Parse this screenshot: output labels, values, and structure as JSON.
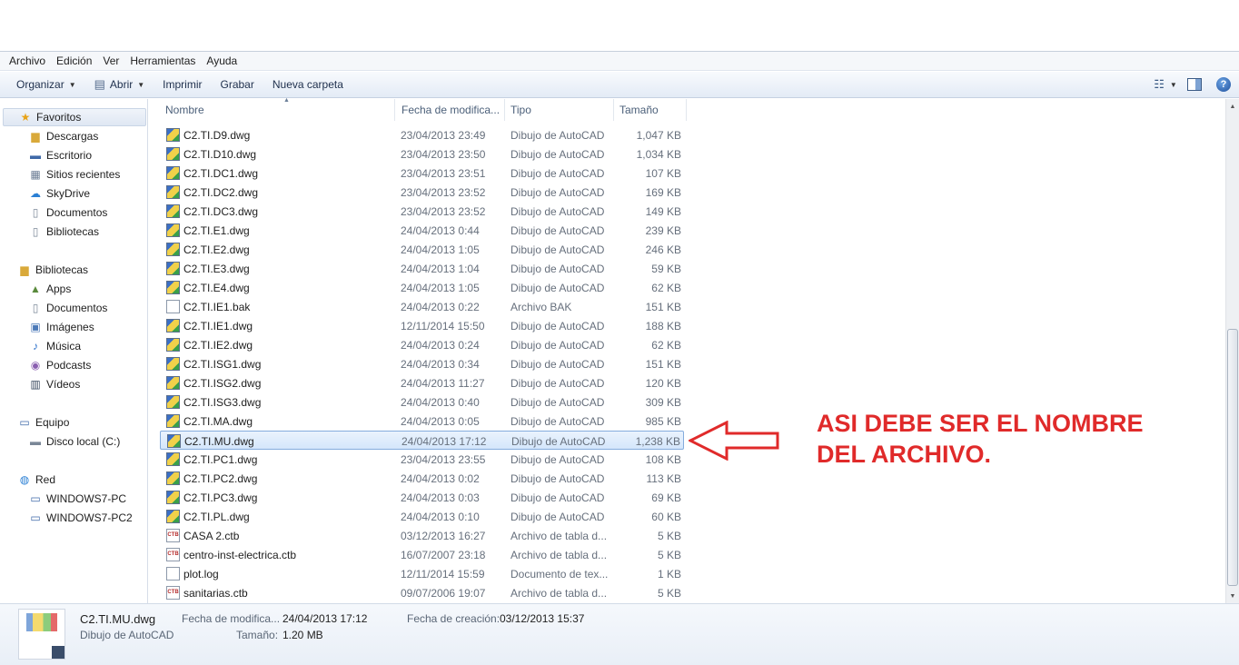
{
  "menu": [
    "Archivo",
    "Edición",
    "Ver",
    "Herramientas",
    "Ayuda"
  ],
  "toolbar": {
    "organize": "Organizar",
    "open": "Abrir",
    "print": "Imprimir",
    "burn": "Grabar",
    "new_folder": "Nueva carpeta"
  },
  "nav": {
    "favorites": "Favoritos",
    "fav_items": [
      "Descargas",
      "Escritorio",
      "Sitios recientes",
      "SkyDrive",
      "Documentos",
      "Bibliotecas"
    ],
    "libraries": "Bibliotecas",
    "lib_items": [
      "Apps",
      "Documentos",
      "Imágenes",
      "Música",
      "Podcasts",
      "Vídeos"
    ],
    "computer": "Equipo",
    "computer_items": [
      "Disco local (C:)"
    ],
    "network": "Red",
    "network_items": [
      "WINDOWS7-PC",
      "WINDOWS7-PC2"
    ]
  },
  "columns": {
    "name": "Nombre",
    "date": "Fecha de modifica...",
    "type": "Tipo",
    "size": "Tamaño"
  },
  "files": [
    {
      "name": "C2.TI.D9.dwg",
      "date": "23/04/2013 23:49",
      "type": "Dibujo de AutoCAD",
      "size": "1,047 KB",
      "icon": "dwg"
    },
    {
      "name": "C2.TI.D10.dwg",
      "date": "23/04/2013 23:50",
      "type": "Dibujo de AutoCAD",
      "size": "1,034 KB",
      "icon": "dwg"
    },
    {
      "name": "C2.TI.DC1.dwg",
      "date": "23/04/2013 23:51",
      "type": "Dibujo de AutoCAD",
      "size": "107 KB",
      "icon": "dwg"
    },
    {
      "name": "C2.TI.DC2.dwg",
      "date": "23/04/2013 23:52",
      "type": "Dibujo de AutoCAD",
      "size": "169 KB",
      "icon": "dwg"
    },
    {
      "name": "C2.TI.DC3.dwg",
      "date": "23/04/2013 23:52",
      "type": "Dibujo de AutoCAD",
      "size": "149 KB",
      "icon": "dwg"
    },
    {
      "name": "C2.TI.E1.dwg",
      "date": "24/04/2013 0:44",
      "type": "Dibujo de AutoCAD",
      "size": "239 KB",
      "icon": "dwg"
    },
    {
      "name": "C2.TI.E2.dwg",
      "date": "24/04/2013 1:05",
      "type": "Dibujo de AutoCAD",
      "size": "246 KB",
      "icon": "dwg"
    },
    {
      "name": "C2.TI.E3.dwg",
      "date": "24/04/2013 1:04",
      "type": "Dibujo de AutoCAD",
      "size": "59 KB",
      "icon": "dwg"
    },
    {
      "name": "C2.TI.E4.dwg",
      "date": "24/04/2013 1:05",
      "type": "Dibujo de AutoCAD",
      "size": "62 KB",
      "icon": "dwg"
    },
    {
      "name": "C2.TI.IE1.bak",
      "date": "24/04/2013 0:22",
      "type": "Archivo BAK",
      "size": "151 KB",
      "icon": "doc"
    },
    {
      "name": "C2.TI.IE1.dwg",
      "date": "12/11/2014 15:50",
      "type": "Dibujo de AutoCAD",
      "size": "188 KB",
      "icon": "dwg"
    },
    {
      "name": "C2.TI.IE2.dwg",
      "date": "24/04/2013 0:24",
      "type": "Dibujo de AutoCAD",
      "size": "62 KB",
      "icon": "dwg"
    },
    {
      "name": "C2.TI.ISG1.dwg",
      "date": "24/04/2013 0:34",
      "type": "Dibujo de AutoCAD",
      "size": "151 KB",
      "icon": "dwg"
    },
    {
      "name": "C2.TI.ISG2.dwg",
      "date": "24/04/2013 11:27",
      "type": "Dibujo de AutoCAD",
      "size": "120 KB",
      "icon": "dwg"
    },
    {
      "name": "C2.TI.ISG3.dwg",
      "date": "24/04/2013 0:40",
      "type": "Dibujo de AutoCAD",
      "size": "309 KB",
      "icon": "dwg"
    },
    {
      "name": "C2.TI.MA.dwg",
      "date": "24/04/2013 0:05",
      "type": "Dibujo de AutoCAD",
      "size": "985 KB",
      "icon": "dwg"
    },
    {
      "name": "C2.TI.MU.dwg",
      "date": "24/04/2013 17:12",
      "type": "Dibujo de AutoCAD",
      "size": "1,238 KB",
      "icon": "dwg",
      "selected": true
    },
    {
      "name": "C2.TI.PC1.dwg",
      "date": "23/04/2013 23:55",
      "type": "Dibujo de AutoCAD",
      "size": "108 KB",
      "icon": "dwg"
    },
    {
      "name": "C2.TI.PC2.dwg",
      "date": "24/04/2013 0:02",
      "type": "Dibujo de AutoCAD",
      "size": "113 KB",
      "icon": "dwg"
    },
    {
      "name": "C2.TI.PC3.dwg",
      "date": "24/04/2013 0:03",
      "type": "Dibujo de AutoCAD",
      "size": "69 KB",
      "icon": "dwg"
    },
    {
      "name": "C2.TI.PL.dwg",
      "date": "24/04/2013 0:10",
      "type": "Dibujo de AutoCAD",
      "size": "60 KB",
      "icon": "dwg"
    },
    {
      "name": "CASA 2.ctb",
      "date": "03/12/2013 16:27",
      "type": "Archivo de tabla d...",
      "size": "5 KB",
      "icon": "ctb"
    },
    {
      "name": "centro-inst-electrica.ctb",
      "date": "16/07/2007 23:18",
      "type": "Archivo de tabla d...",
      "size": "5 KB",
      "icon": "ctb"
    },
    {
      "name": "plot.log",
      "date": "12/11/2014 15:59",
      "type": "Documento de tex...",
      "size": "1 KB",
      "icon": "doc"
    },
    {
      "name": "sanitarias.ctb",
      "date": "09/07/2006 19:07",
      "type": "Archivo de tabla d...",
      "size": "5 KB",
      "icon": "ctb"
    }
  ],
  "annotation": {
    "line1": "ASI DEBE SER EL NOMBRE",
    "line2": "DEL ARCHIVO.",
    "color": "#e02a2a"
  },
  "details": {
    "name": "C2.TI.MU.dwg",
    "type": "Dibujo de AutoCAD",
    "modified_label": "Fecha de modifica...",
    "modified_value": "24/04/2013 17:12",
    "created_label": "Fecha de creación:",
    "created_value": "03/12/2013 15:37",
    "size_label": "Tamaño:",
    "size_value": "1.20 MB"
  },
  "colors": {
    "selection_border": "#84acdd",
    "toolbar_text": "#1e2f4c"
  }
}
